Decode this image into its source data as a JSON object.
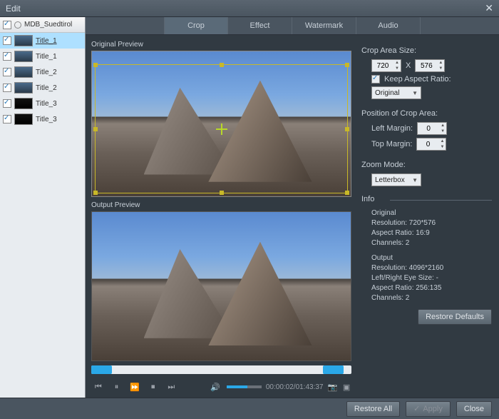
{
  "window": {
    "title": "Edit"
  },
  "sidebar": {
    "root": "MDB_Suedtirol",
    "items": [
      {
        "label": "Title_1"
      },
      {
        "label": "Title_1"
      },
      {
        "label": "Title_2"
      },
      {
        "label": "Title_2"
      },
      {
        "label": "Title_3"
      },
      {
        "label": "Title_3"
      }
    ]
  },
  "tabs": {
    "crop": "Crop",
    "effect": "Effect",
    "watermark": "Watermark",
    "audio": "Audio"
  },
  "previews": {
    "original_label": "Original Preview",
    "output_label": "Output Preview"
  },
  "player": {
    "time": "00:00:02/01:43:37"
  },
  "crop": {
    "size_label": "Crop Area Size:",
    "width": "720",
    "x": "X",
    "height": "576",
    "keep_aspect_label": "Keep Aspect Ratio:",
    "aspect_value": "Original",
    "position_label": "Position of Crop Area:",
    "left_margin_label": "Left Margin:",
    "left_margin": "0",
    "top_margin_label": "Top Margin:",
    "top_margin": "0",
    "zoom_label": "Zoom Mode:",
    "zoom_value": "Letterbox"
  },
  "info": {
    "heading": "Info",
    "original_label": "Original",
    "orig_res": "Resolution: 720*576",
    "orig_ar": "Aspect Ratio: 16:9",
    "orig_ch": "Channels: 2",
    "output_label": "Output",
    "out_res": "Resolution: 4096*2160",
    "out_eye": "Left/Right Eye Size: -",
    "out_ar": "Aspect Ratio: 256:135",
    "out_ch": "Channels: 2"
  },
  "buttons": {
    "restore_defaults": "Restore Defaults",
    "restore_all": "Restore All",
    "apply": "Apply",
    "close": "Close"
  }
}
